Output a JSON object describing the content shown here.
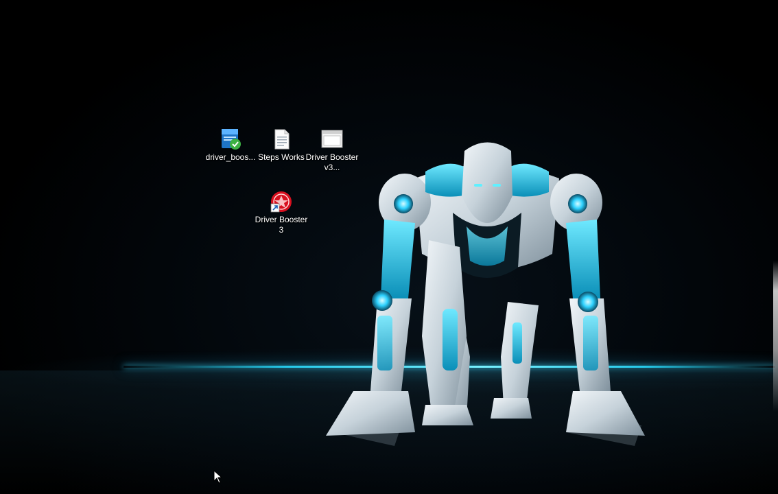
{
  "desktop": {
    "accent_color": "#3ad4ff",
    "icons": [
      {
        "label": "driver_boos...",
        "icon": "file-installer-icon"
      },
      {
        "label": "Steps Works",
        "icon": "text-document-icon"
      },
      {
        "label": "Driver Booster v3...",
        "icon": "application-window-icon"
      },
      {
        "label": "Driver Booster 3",
        "icon": "driver-booster-shortcut-icon"
      }
    ]
  },
  "cursor": {
    "icon": "mouse-pointer-icon"
  }
}
